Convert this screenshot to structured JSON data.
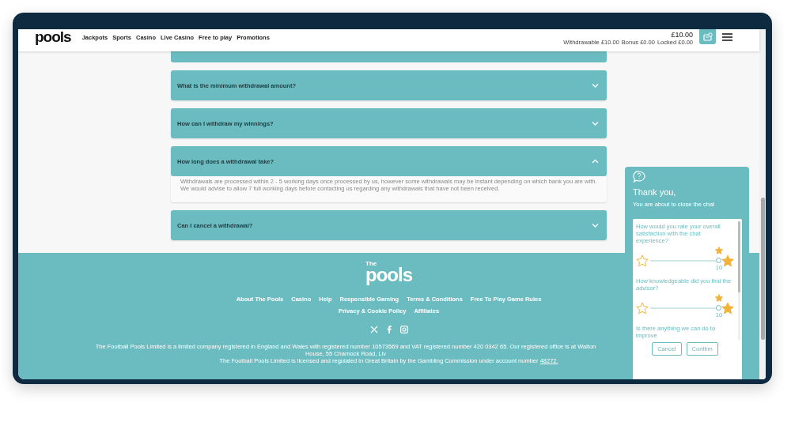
{
  "header": {
    "logo": "pools",
    "nav": [
      "Jackpots",
      "Sports",
      "Casino",
      "Live Casino",
      "Free to play",
      "Promotions"
    ],
    "balance": "£10.00",
    "balance_details": [
      {
        "label": "Withdrawable",
        "value": "£10.00"
      },
      {
        "label": "Bonus",
        "value": "£0.00"
      },
      {
        "label": "Locked",
        "value": "£0.00"
      }
    ]
  },
  "faq": [
    {
      "question": "What is the minimum withdrawal amount?",
      "expanded": false
    },
    {
      "question": "How can I withdraw my winnings?",
      "expanded": false
    },
    {
      "question": "How long does a withdrawal take?",
      "expanded": true,
      "answer": "Withdrawals are processed within 2 - 5 working days once processed by us, however some withdrawals may be instant depending on which bank you are with. We would advise to allow 7 full working days before contacting us regarding any withdrawals that have not been received."
    },
    {
      "question": "Can I cancel a withdrawal?",
      "expanded": false
    }
  ],
  "footer": {
    "logo_small": "The",
    "logo_big": "pools",
    "link_rows": [
      [
        "About The Pools",
        "Casino",
        "Help",
        "Responsible Gaming",
        "Terms & Conditions",
        "Free To Play Game Rules"
      ],
      [
        "Privacy & Cookie Policy",
        "Affiliates"
      ]
    ],
    "legal_line_1": "The Football Pools Limited is a limited company registered in England and Wales with registered number 10573569 and VAT registered number 420 0342 65. Our registered office is at Walton House, 55 Charnock Road, Liv",
    "legal_line_2": "The Football Pools Limited is licensed and regulated in Great Britain by the Gambling Commission under account number",
    "legal_link": "48272."
  },
  "chat": {
    "title": "Thank you,",
    "subtitle": "You are about to close the chat",
    "questions": [
      {
        "kind": "rating",
        "text": "How would you rate your overall satisfaction with the chat experience?",
        "level": 1,
        "reading": "10"
      },
      {
        "kind": "rating",
        "text": "How knowledgeable did you find the advisor?",
        "level": 1,
        "reading": "10"
      },
      {
        "kind": "text",
        "text": "Is there anything we can do to improve"
      }
    ],
    "buttons": [
      "Cancel",
      "Confirm"
    ]
  }
}
